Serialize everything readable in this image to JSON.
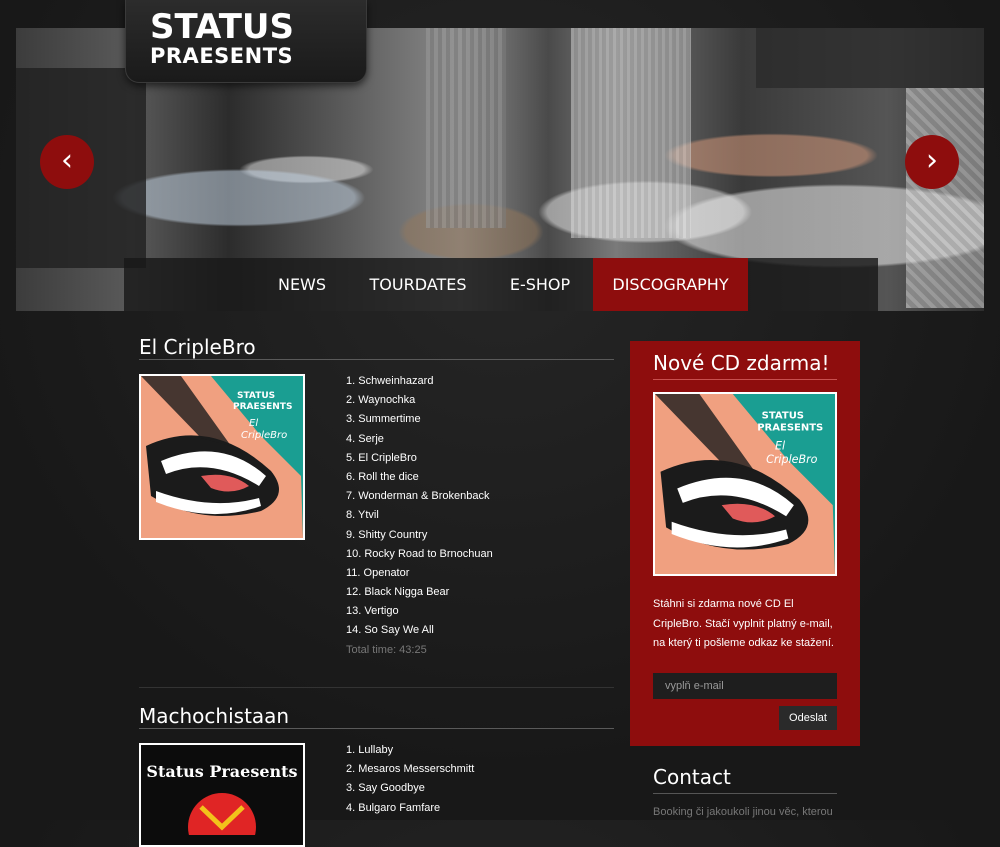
{
  "brand": {
    "line1": "STATUS",
    "line2": "PRAESENTS"
  },
  "slider": {
    "prev_icon": "chevron-left-icon",
    "next_icon": "chevron-right-icon",
    "prev_glyph": "‹",
    "next_glyph": "›"
  },
  "nav": [
    {
      "label": "NEWS",
      "active": false
    },
    {
      "label": "TOURDATES",
      "active": false
    },
    {
      "label": "E-SHOP",
      "active": false
    },
    {
      "label": "DISCOGRAPHY",
      "active": true
    }
  ],
  "albums": [
    {
      "title": "El CripleBro",
      "cover_text": "STATUS PRAESENTS El CripleBro",
      "tracks": [
        "1. Schweinhazard",
        "2. Waynochka",
        "3. Summertime",
        "4. Serje",
        "5. El CripleBro",
        "6. Roll the dice",
        "7. Wonderman & Brokenback",
        "8. Ytvil",
        "9. Shitty Country",
        "10. Rocky Road to Brnochuan",
        "11. Openator",
        "12. Black Nigga Bear",
        "13. Vertigo",
        "14. So Say We All"
      ],
      "total": "Total time: 43:25"
    },
    {
      "title": "Machochistaan",
      "cover_text": "Status Praesents",
      "tracks": [
        "1. Lullaby",
        "2. Mesaros Messerschmitt",
        "3. Say Goodbye",
        "4. Bulgaro Famfare"
      ]
    }
  ],
  "promo": {
    "title": "Nové CD zdarma!",
    "text": "Stáhni si zdarma nové CD El CripleBro. Stačí vyplnit platný e-mail, na který ti pošleme odkaz ke stažení.",
    "email_placeholder": "vyplň e-mail",
    "submit_label": "Odeslat"
  },
  "contact": {
    "title": "Contact",
    "text": "Booking či jakoukoli jinou věc, kterou"
  },
  "colors": {
    "accent": "#8e0d0d",
    "background": "#1b1b1b",
    "cover_teal": "#1a9e92",
    "cover_orange": "#f0a080"
  }
}
